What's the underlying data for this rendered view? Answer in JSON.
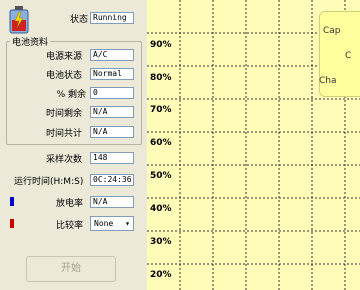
{
  "status": {
    "label": "状态",
    "value": "Running"
  },
  "battery": {
    "group_title": "电池资料",
    "rows": [
      {
        "label": "电源来源",
        "value": "A/C"
      },
      {
        "label": "电池状态",
        "value": "Normal"
      },
      {
        "label": "% 剩余",
        "value": "0"
      },
      {
        "label": "时间剩余",
        "value": "N/A"
      },
      {
        "label": "时间共计",
        "value": "N/A"
      }
    ]
  },
  "sampling": {
    "label": "采样次数",
    "value": "148"
  },
  "runtime": {
    "label": "运行时间(H:M:S)",
    "value": "0C:24:36"
  },
  "discharge": {
    "label": "放电率",
    "value": "N/A",
    "color": "#0000cc"
  },
  "ratio": {
    "label": "比较率",
    "selected": "None",
    "color": "#cc0000"
  },
  "start_button": {
    "label": "开始"
  },
  "chart": {
    "y_ticks": [
      "90%",
      "80%",
      "70%",
      "60%",
      "50%",
      "40%",
      "30%",
      "20%"
    ],
    "legend": [
      "Cap",
      "C",
      "Cha"
    ],
    "background": "#fffcb8",
    "grid_color": "#333333"
  }
}
